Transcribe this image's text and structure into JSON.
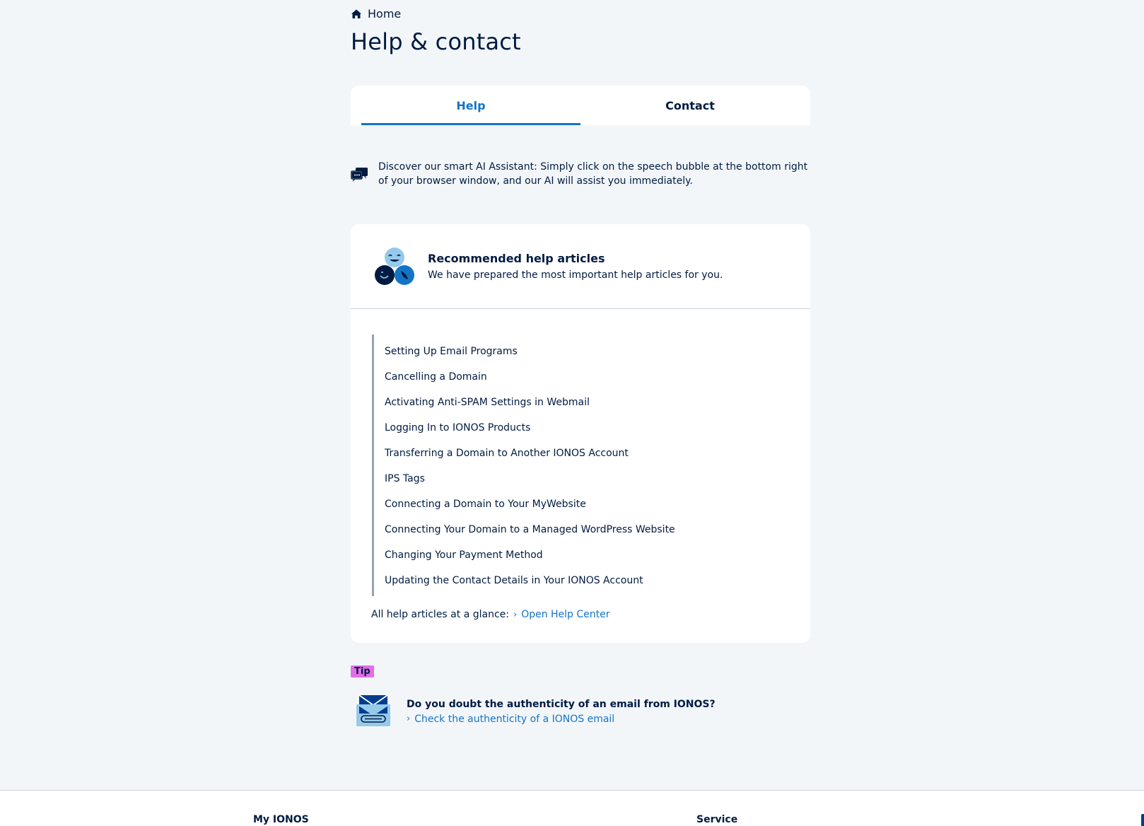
{
  "breadcrumb": {
    "icon": "home-icon",
    "label": "Home"
  },
  "page_title": "Help & contact",
  "tabs": [
    {
      "label": "Help",
      "active": true
    },
    {
      "label": "Contact",
      "active": false
    }
  ],
  "ai_note": {
    "icon": "chat-bubbles-icon",
    "text": "Discover our smart AI Assistant: Simply click on the speech bubble at the bottom right of your browser window, and our AI will assist you immediately."
  },
  "recommended": {
    "title": "Recommended help articles",
    "subtitle": "We have prepared the most important help articles for you.",
    "articles": [
      "Setting Up Email Programs",
      "Cancelling a Domain",
      "Activating Anti-SPAM Settings in Webmail",
      "Logging In to IONOS Products",
      "Transferring a Domain to Another IONOS Account",
      "IPS Tags",
      "Connecting a Domain to Your MyWebsite",
      "Connecting Your Domain to a Managed WordPress Website",
      "Changing Your Payment Method",
      "Updating the Contact Details in Your IONOS Account"
    ],
    "all_label": "All help articles at a glance:",
    "all_link": "Open Help Center"
  },
  "tip": {
    "badge": "Tip",
    "title": "Do you doubt the authenticity of an email from IONOS?",
    "link": "Check the authenticity of a IONOS email"
  },
  "footer": {
    "col1": "My IONOS",
    "col2": "Service"
  },
  "colors": {
    "background": "#f3f6f9",
    "text": "#001b41",
    "link": "#1474c4",
    "tip_badge": "#e26ee8"
  }
}
